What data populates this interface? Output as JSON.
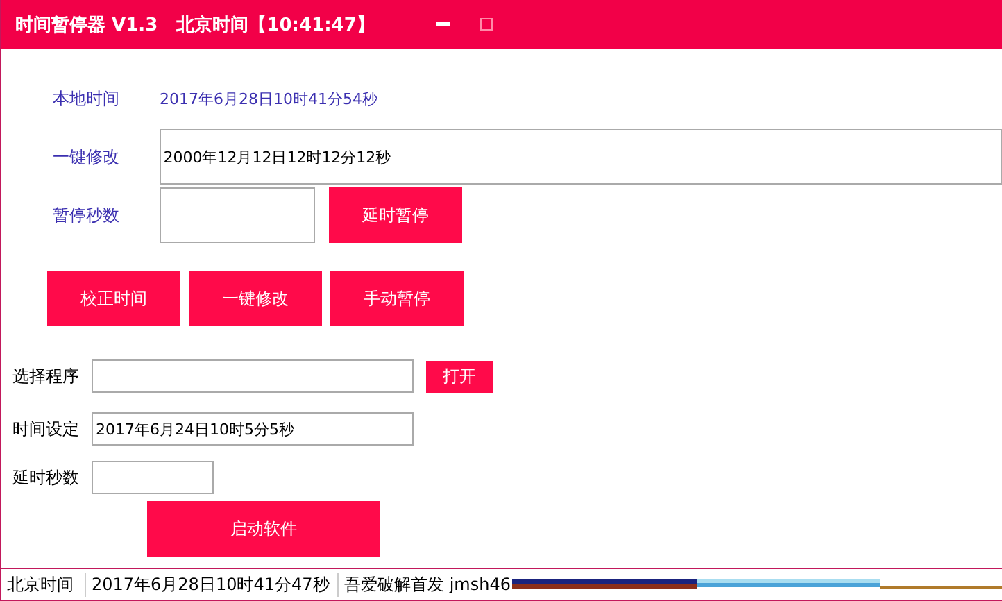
{
  "window": {
    "title": "时间暂停器 V1.3   北京时间【10:41:47】"
  },
  "local_time": {
    "label": "本地时间",
    "value": "2017年6月28日10时41分54秒"
  },
  "one_click": {
    "label": "一键修改",
    "value": "2000年12月12日12时12分12秒"
  },
  "pause_seconds": {
    "label": "暂停秒数",
    "button": "延时暂停"
  },
  "actions": [
    "校正时间",
    "一键修改",
    "手动暂停"
  ],
  "program": {
    "label": "选择程序",
    "button": "打开"
  },
  "time_setting": {
    "label": "时间设定",
    "value": "2017年6月24日10时5分5秒"
  },
  "delay_seconds": {
    "label": "延时秒数"
  },
  "launch_button": "启动软件",
  "status_bar": [
    "北京时间",
    "2017年6月28日10时41分47秒",
    "吾爱破解首发 jmsh46"
  ]
}
